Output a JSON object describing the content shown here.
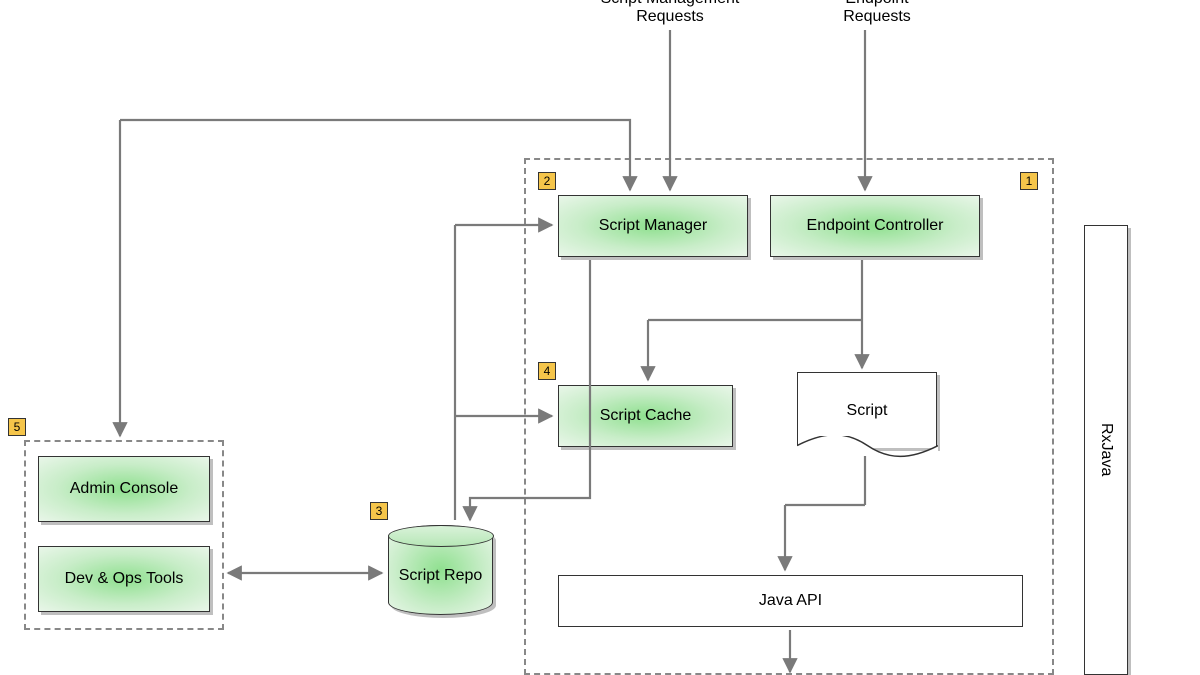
{
  "inputs": {
    "script_mgmt": "Script Management\nRequests",
    "endpoint": "Endpoint\nRequests"
  },
  "badges": {
    "b1": "1",
    "b2": "2",
    "b3": "3",
    "b4": "4",
    "b5": "5"
  },
  "nodes": {
    "script_manager": "Script Manager",
    "endpoint_controller": "Endpoint Controller",
    "script_cache": "Script Cache",
    "script_doc": "Script",
    "java_api": "Java API",
    "script_repo": "Script Repo",
    "admin_console": "Admin Console",
    "devops_tools": "Dev & Ops Tools",
    "rxjava": "RxJava"
  }
}
